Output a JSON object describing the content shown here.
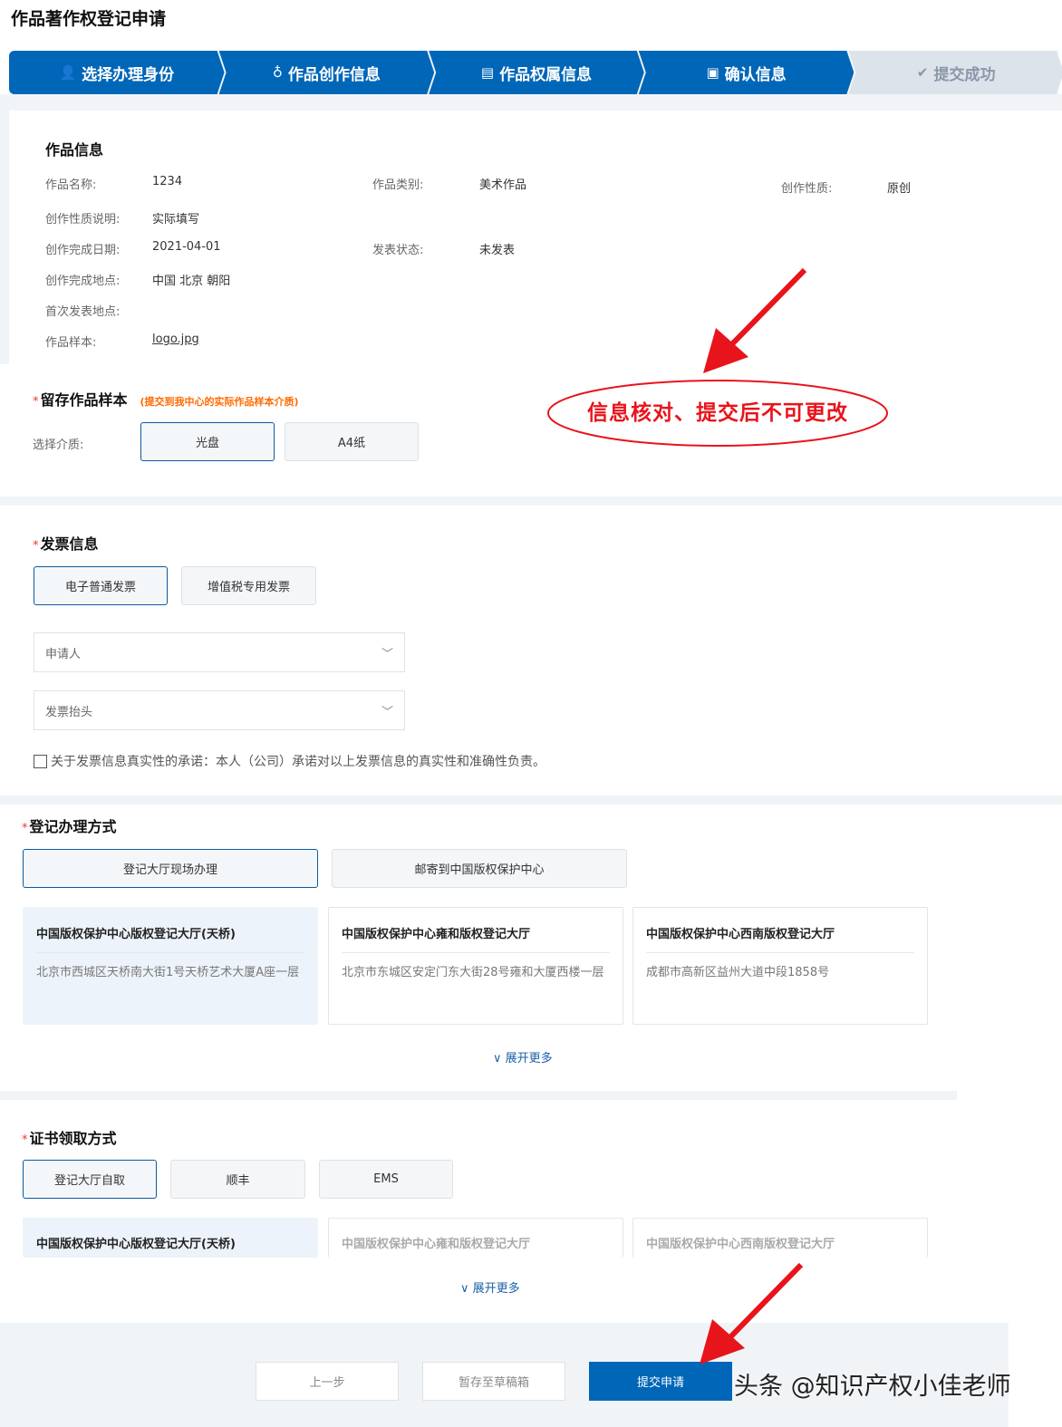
{
  "title": "作品著作权登记申请",
  "steps": [
    {
      "label": "选择办理身份",
      "icon": "user-icon"
    },
    {
      "label": "作品创作信息",
      "icon": "lightbulb-icon"
    },
    {
      "label": "作品权属信息",
      "icon": "document-icon"
    },
    {
      "label": "确认信息",
      "icon": "confirm-icon"
    },
    {
      "label": "提交成功",
      "icon": "check-circle-icon"
    }
  ],
  "work_info": {
    "heading": "作品信息",
    "name_label": "作品名称:",
    "name": "1234",
    "type_label": "作品类别:",
    "type": "美术作品",
    "nature_label": "创作性质:",
    "nature": "原创",
    "nature_desc_label": "创作性质说明:",
    "nature_desc": "实际填写",
    "date_label": "创作完成日期:",
    "date": "2021-04-01",
    "publish_label": "发表状态:",
    "publish": "未发表",
    "place_label": "创作完成地点:",
    "place": "中国 北京 朝阳",
    "first_pub_label": "首次发表地点:",
    "sample_label": "作品样本:",
    "sample": "logo.jpg"
  },
  "sample": {
    "heading": "留存作品样本",
    "hint": "(提交到我中心的实际作品样本介质)",
    "medium_label": "选择介质:",
    "options": [
      "光盘",
      "A4纸"
    ]
  },
  "invoice": {
    "heading": "发票信息",
    "types": [
      "电子普通发票",
      "增值税专用发票"
    ],
    "applicant_placeholder": "申请人",
    "title_placeholder": "发票抬头",
    "pledge": "关于发票信息真实性的承诺：本人（公司）承诺对以上发票信息的真实性和准确性负责。"
  },
  "handling": {
    "heading": "登记办理方式",
    "options": [
      "登记大厅现场办理",
      "邮寄到中国版权保护中心"
    ],
    "halls": [
      {
        "name": "中国版权保护中心版权登记大厅(天桥)",
        "addr": "北京市西城区天桥南大街1号天桥艺术大厦A座一层"
      },
      {
        "name": "中国版权保护中心雍和版权登记大厅",
        "addr": "北京市东城区安定门东大街28号雍和大厦西楼一层"
      },
      {
        "name": "中国版权保护中心西南版权登记大厅",
        "addr": "成都市高新区益州大道中段1858号"
      }
    ],
    "more": "展开更多"
  },
  "certificate": {
    "heading": "证书领取方式",
    "options": [
      "登记大厅自取",
      "顺丰",
      "EMS"
    ],
    "halls": [
      "中国版权保护中心版权登记大厅(天桥)",
      "中国版权保护中心雍和版权登记大厅",
      "中国版权保护中心西南版权登记大厅"
    ],
    "more": "展开更多"
  },
  "footer": {
    "prev": "上一步",
    "draft": "暂存至草稿箱",
    "submit": "提交申请"
  },
  "annotation": "信息核对、提交后不可更改",
  "watermark": "头条 @知识产权小佳老师",
  "colors": {
    "primary": "#0066b8",
    "annotation": "#e8141b",
    "hint": "#ff6a00"
  }
}
